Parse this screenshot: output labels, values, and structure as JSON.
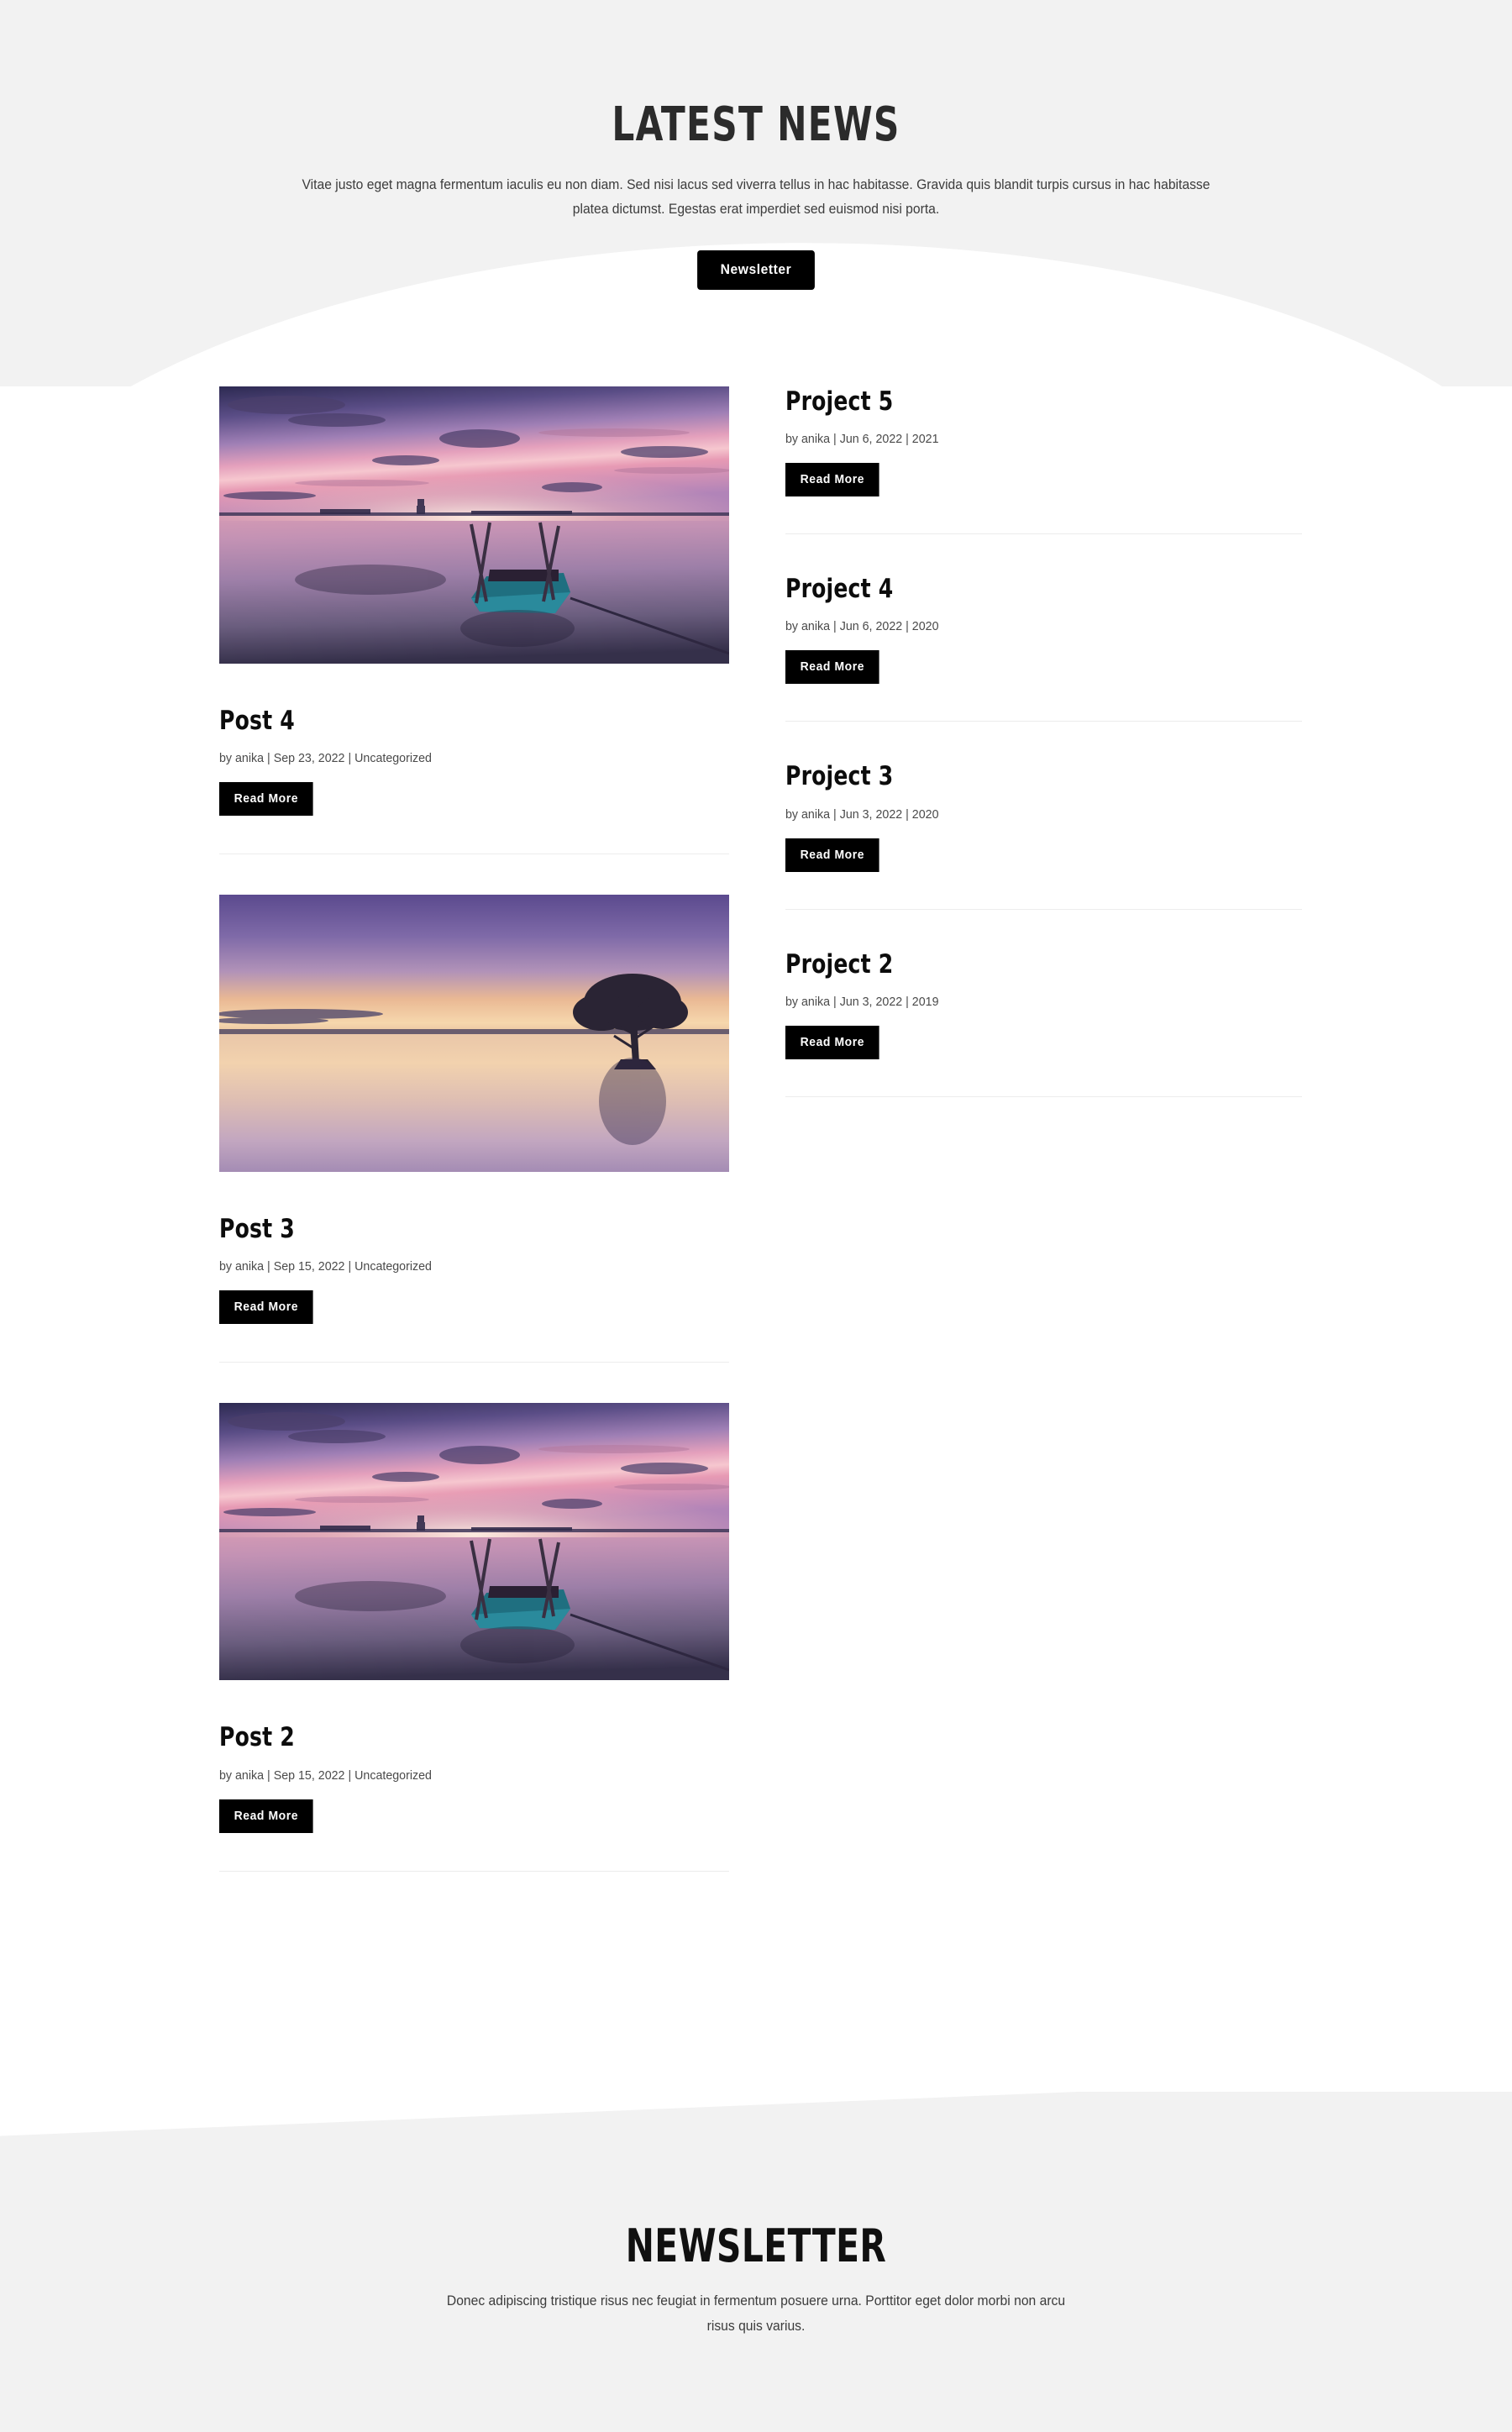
{
  "hero": {
    "title": "LATEST NEWS",
    "description": "Vitae justo eget magna fermentum iaculis eu non diam. Sed nisi lacus sed viverra tellus in hac habitasse. Gravida quis blandit turpis cursus in hac habitasse platea dictumst. Egestas erat imperdiet sed euismod nisi porta.",
    "newsletter_button": "Newsletter"
  },
  "posts": [
    {
      "title": "Post 4",
      "meta": "by anika | Sep 23, 2022 | Uncategorized",
      "read_more": "Read More",
      "image_name": "boat-sunset-photo"
    },
    {
      "title": "Post 3",
      "meta": "by anika | Sep 15, 2022 | Uncategorized",
      "read_more": "Read More",
      "image_name": "lone-tree-dusk-photo"
    },
    {
      "title": "Post 2",
      "meta": "by anika | Sep 15, 2022 | Uncategorized",
      "read_more": "Read More",
      "image_name": "boat-sunset-photo"
    }
  ],
  "projects": [
    {
      "title": "Project 5",
      "meta": "by anika | Jun 6, 2022 | 2021",
      "read_more": "Read More"
    },
    {
      "title": "Project 4",
      "meta": "by anika | Jun 6, 2022 | 2020",
      "read_more": "Read More"
    },
    {
      "title": "Project 3",
      "meta": "by anika | Jun 3, 2022 | 2020",
      "read_more": "Read More"
    },
    {
      "title": "Project 2",
      "meta": "by anika | Jun 3, 2022 | 2019",
      "read_more": "Read More"
    }
  ],
  "footer": {
    "title": "NEWSLETTER",
    "description": "Donec adipiscing tristique risus nec feugiat in fermentum posuere urna. Porttitor eget dolor morbi non arcu risus quis varius."
  },
  "colors": {
    "section_background": "#f2f2f2",
    "page_background": "#ffffff",
    "button_background": "#000000",
    "button_text": "#ffffff",
    "heading_text": "#0c0c0c",
    "meta_text": "#4a4a4a",
    "divider": "#ececec"
  }
}
